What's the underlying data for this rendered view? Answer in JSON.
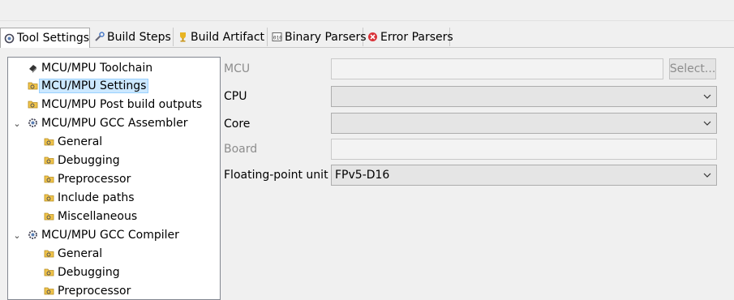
{
  "tabs": [
    {
      "label": "Tool Settings",
      "icon": "tool-settings-icon",
      "active": true
    },
    {
      "label": "Build Steps",
      "icon": "build-steps-icon"
    },
    {
      "label": "Build Artifact",
      "icon": "build-artifact-icon"
    },
    {
      "label": "Binary Parsers",
      "icon": "binary-parsers-icon"
    },
    {
      "label": "Error Parsers",
      "icon": "error-parsers-icon"
    }
  ],
  "tree": {
    "items": [
      {
        "label": "MCU/MPU Toolchain",
        "icon": "chip-icon"
      },
      {
        "label": "MCU/MPU Settings",
        "icon": "settings-folder-icon",
        "selected": true
      },
      {
        "label": "MCU/MPU Post build outputs",
        "icon": "settings-folder-icon"
      },
      {
        "label": "MCU/MPU GCC Assembler",
        "icon": "gear-icon",
        "expanded": true
      },
      {
        "label": "General",
        "icon": "settings-folder-icon"
      },
      {
        "label": "Debugging",
        "icon": "settings-folder-icon"
      },
      {
        "label": "Preprocessor",
        "icon": "settings-folder-icon"
      },
      {
        "label": "Include paths",
        "icon": "settings-folder-icon"
      },
      {
        "label": "Miscellaneous",
        "icon": "settings-folder-icon"
      },
      {
        "label": "MCU/MPU GCC Compiler",
        "icon": "gear-icon",
        "expanded": true
      },
      {
        "label": "General",
        "icon": "settings-folder-icon"
      },
      {
        "label": "Debugging",
        "icon": "settings-folder-icon"
      },
      {
        "label": "Preprocessor",
        "icon": "settings-folder-icon"
      }
    ]
  },
  "form": {
    "mcu_label": "MCU",
    "mcu_value": "",
    "select_button": "Select...",
    "cpu_label": "CPU",
    "cpu_value": "",
    "core_label": "Core",
    "core_value": "",
    "board_label": "Board",
    "board_value": "",
    "fpu_label": "Floating-point unit",
    "fpu_value": "FPv5-D16"
  },
  "colors": {
    "selection_bg": "#cce8ff",
    "window_bg": "#f0f0f0",
    "disabled_text": "#8d8d8d"
  }
}
